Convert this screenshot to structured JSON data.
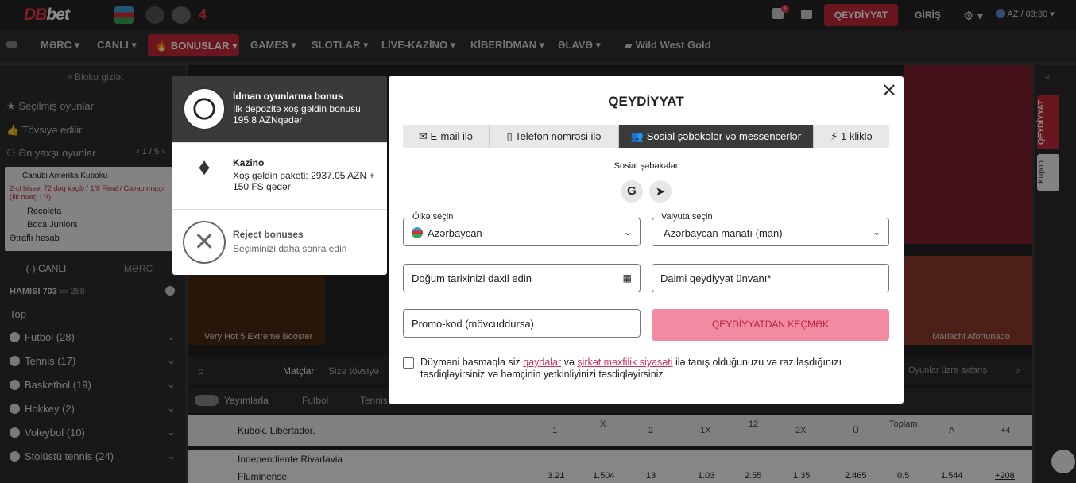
{
  "header": {
    "logo_db": "DB",
    "logo_bet": "bet",
    "register_label": "QEYDİYYAT",
    "login_label": "GİRİŞ",
    "lang_time": "AZ / 03:30",
    "gift_badge": "1"
  },
  "nav": {
    "items": [
      "MƏRC",
      "CANLI",
      "BONUSLAR",
      "GAMES",
      "SLOTLAR",
      "LİVE-KAZİNO",
      "KİBERİDMAN",
      "ƏLAVƏ",
      "Wild West Gold"
    ]
  },
  "sidebar": {
    "hide_block": "Bloku gizlət",
    "favorites": "Seçilmiş oyunlar",
    "recommended": "Tövsiyə edilir",
    "best_games": "Ən yaxşı oyunlar",
    "best_pager": "1 / 5",
    "match_league": "Canubi Amerika Kuboku",
    "match_status": "2-ci hissə, 72 dəq keçib / 1/8 Final / Cavab matçı (İlk matç 1:3)",
    "team1": "Recoleta",
    "team2": "Boca Juniors",
    "details": "Ətraflı hesab",
    "tab_live": "CANLI",
    "tab_bet": "MƏRC",
    "all_count": "HAMISI 703",
    "video_count": "288",
    "top": "Top",
    "sports": [
      {
        "name": "Futbol (28)"
      },
      {
        "name": "Tennis (17)"
      },
      {
        "name": "Basketbol (19)"
      },
      {
        "name": "Hokkey (2)"
      },
      {
        "name": "Voleybol (10)"
      },
      {
        "name": "Stolüstü tennis (24)"
      }
    ]
  },
  "main": {
    "tile_1": "Very Hot 5 Extreme Booster",
    "tile_2": "Mariachi Afortunado",
    "matches_tab": "Matçlar",
    "recommend_tab": "Sizə tövsiyə",
    "search_placeholder": "Oyunlar üzrə axtarış",
    "streams": "Yayımlarla",
    "football": "Futbol",
    "tennis": "Tennis",
    "league": "Kubok. Libertador.",
    "cols": [
      "1",
      "X",
      "2",
      "1X",
      "12",
      "2X",
      "Ü",
      "Toplam",
      "A",
      "+4"
    ],
    "row1_team": "Independiente Rivadavia",
    "row2_team": "Fluminense",
    "row2_odds": [
      "3.21",
      "1.504",
      "13",
      "1.03",
      "2.55",
      "1.35",
      "2.465",
      "0.5",
      "1.544",
      "+208"
    ]
  },
  "rightbar": {
    "register_vertical": "QEYDİYYAT",
    "coupon_vertical": "Kupon"
  },
  "bonus_panel": {
    "items": [
      {
        "title": "İdman oyunlarına bonus",
        "text": "İlk depozitə xoş gəldin bonusu 195.8 AZNqədər",
        "icon": "soccer-ball-icon"
      },
      {
        "title": "Kazino",
        "text": "Xoş gəldin paketi: 2937.05 AZN + 150 FS qədər",
        "icon": "casino-chips-icon"
      },
      {
        "title": "Reject bonuses",
        "text": "Seçiminizi daha sonra edin",
        "icon": "reject-icon"
      }
    ]
  },
  "modal": {
    "title": "QEYDİYYAT",
    "tabs": [
      "E-mail ilə",
      "Telefon nömrəsi ilə",
      "Sosial şəbəkələr və messencerlər",
      "1 kliklə"
    ],
    "social_label": "Sosial şəbəkələr",
    "country_label": "Ölkə seçin",
    "country_value": "Azərbaycan",
    "currency_label": "Valyuta seçin",
    "currency_value": "Azərbaycan manatı (man)",
    "dob_placeholder": "Doğum tarixinizi daxil edin",
    "address_placeholder": "Daimi qeydiyyat ünvanı*",
    "promo_placeholder": "Promo-kod (mövcuddursa)",
    "submit_label": "QEYDİYYATDAN KEÇMƏK",
    "consent_1": "Düyməni basmaqla siz ",
    "consent_link1": "qaydalar",
    "consent_2": " və ",
    "consent_link2": "şirkət məxfilik siyasəti",
    "consent_3": " ilə tanış olduğunuzu və razılaşdığınızı təsdiqləyirsiniz və həmçinin yetkinliyinizi təsdiqləyirsiniz"
  }
}
